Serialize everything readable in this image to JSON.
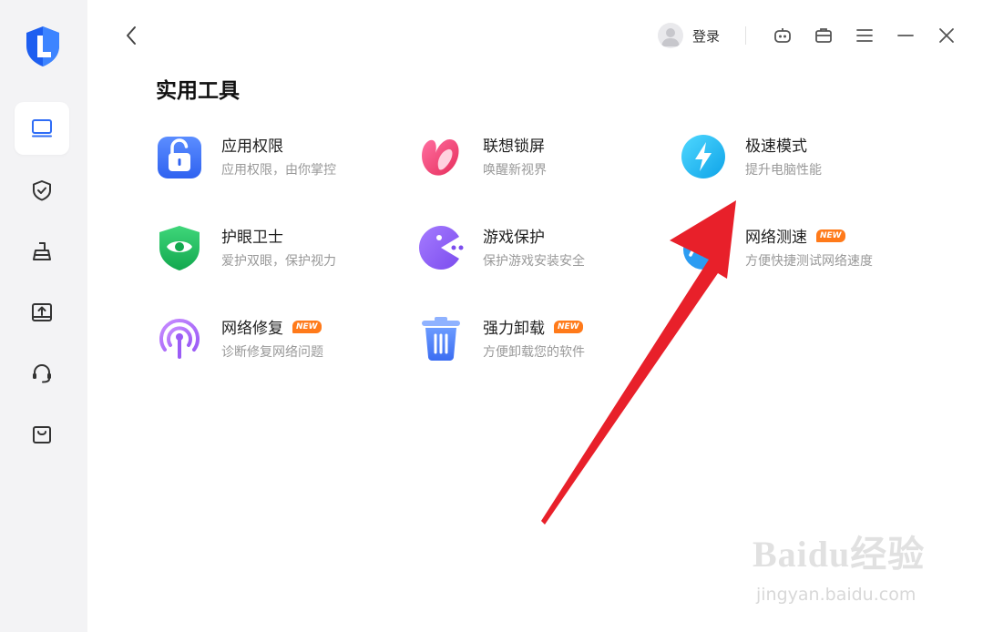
{
  "header": {
    "login_label": "登录"
  },
  "section": {
    "title": "实用工具"
  },
  "tools": [
    {
      "name": "应用权限",
      "desc": "应用权限，由你掌控",
      "badge": ""
    },
    {
      "name": "联想锁屏",
      "desc": "唤醒新视界",
      "badge": ""
    },
    {
      "name": "极速模式",
      "desc": "提升电脑性能",
      "badge": ""
    },
    {
      "name": "护眼卫士",
      "desc": "爱护双眼，保护视力",
      "badge": ""
    },
    {
      "name": "游戏保护",
      "desc": "保护游戏安装安全",
      "badge": ""
    },
    {
      "name": "网络测速",
      "desc": "方便快捷测试网络速度",
      "badge": "NEW"
    },
    {
      "name": "网络修复",
      "desc": "诊断修复网络问题",
      "badge": "NEW"
    },
    {
      "name": "强力卸载",
      "desc": "方便卸载您的软件",
      "badge": "NEW"
    }
  ],
  "watermark": {
    "brand": "Baidu经验",
    "url": "jingyan.baidu.com"
  },
  "colors": {
    "sidebar_bg": "#f3f3f5",
    "accent_blue": "#2f6df6",
    "badge_orange": "#ff7a1a",
    "arrow_red": "#e8202a"
  }
}
